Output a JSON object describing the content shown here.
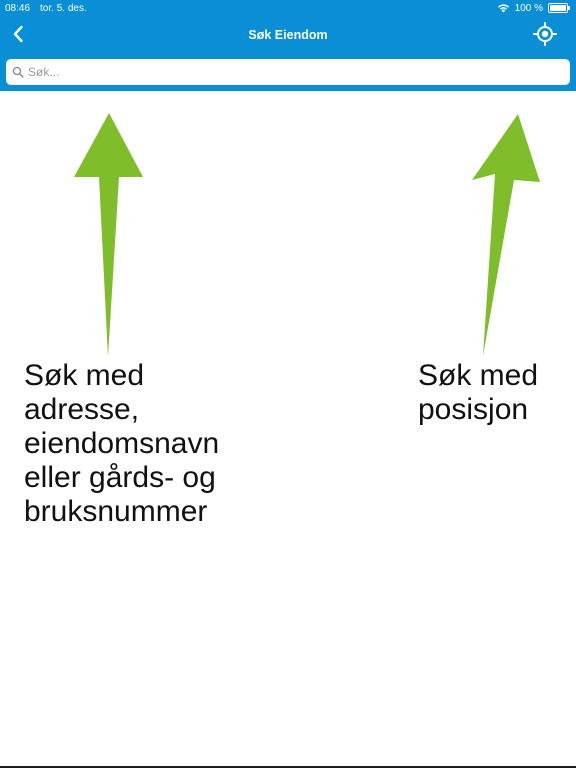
{
  "status_bar": {
    "time": "08:46",
    "date": "tor. 5. des.",
    "battery_text": "100 %",
    "battery_level": 1.0,
    "wifi_icon": "wifi-icon"
  },
  "nav": {
    "title": "Søk Eiendom",
    "back_icon": "chevron-left-icon",
    "locate_icon": "crosshair-icon"
  },
  "search": {
    "placeholder": "Søk...",
    "value": "",
    "icon": "search-icon"
  },
  "hints": {
    "search_hint": "Søk med\nadresse,\neiendomsnavn\neller gårds- og\nbruksnummer",
    "position_hint": "Søk med\nposisjon"
  },
  "colors": {
    "primary": "#0a8fd6",
    "arrow": "#80bd2a",
    "text": "#111111"
  }
}
